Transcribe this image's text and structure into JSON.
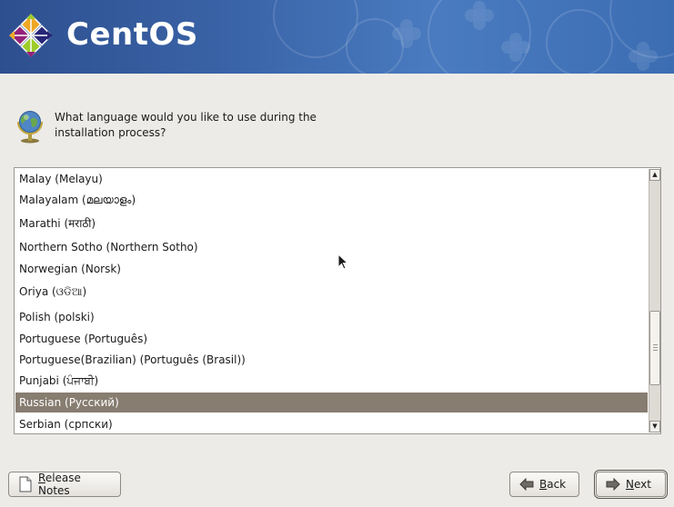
{
  "banner": {
    "brand": "CentOS"
  },
  "prompt": {
    "question": "What language would you like to use during the installation process?"
  },
  "languages": [
    {
      "label": "Malay (Melayu)",
      "selected": false
    },
    {
      "label": "Malayalam (മലയാളം)",
      "selected": false
    },
    {
      "label": "Marathi (मराठी)",
      "selected": false
    },
    {
      "label": "Northern Sotho (Northern Sotho)",
      "selected": false
    },
    {
      "label": "Norwegian (Norsk)",
      "selected": false
    },
    {
      "label": "Oriya (ଓଡିଆ)",
      "selected": false
    },
    {
      "label": "Polish (polski)",
      "selected": false
    },
    {
      "label": "Portuguese (Português)",
      "selected": false
    },
    {
      "label": "Portuguese(Brazilian) (Português (Brasil))",
      "selected": false
    },
    {
      "label": "Punjabi (ਪੰਜਾਬੀ)",
      "selected": false
    },
    {
      "label": "Russian (Русский)",
      "selected": true
    },
    {
      "label": "Serbian (српски)",
      "selected": false
    }
  ],
  "buttons": {
    "release_notes": {
      "prefix": "",
      "accel": "R",
      "rest": "elease Notes"
    },
    "back": {
      "prefix": "",
      "accel": "B",
      "rest": "ack"
    },
    "next": {
      "prefix": "",
      "accel": "N",
      "rest": "ext"
    }
  },
  "colors": {
    "banner": "#3a64a8",
    "selection": "#877d70",
    "window": "#edebe7"
  }
}
